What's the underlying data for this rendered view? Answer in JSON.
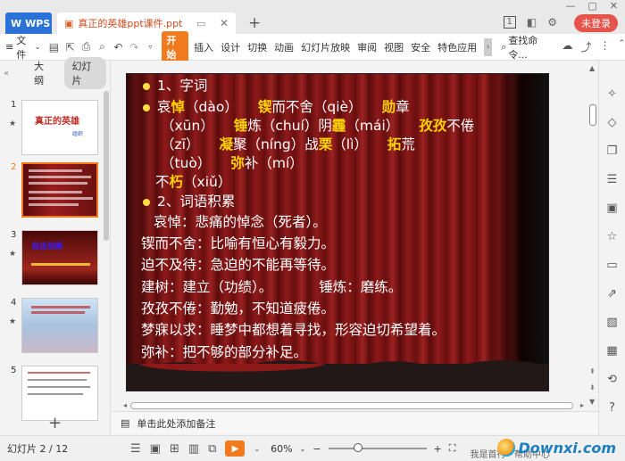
{
  "titlebar": {
    "app_tab": "WPS",
    "doc_tab": "真正的英雄ppt课件.ppt",
    "new_tab": "+",
    "badge": "1",
    "login": "未登录"
  },
  "toolbar": {
    "file": "文件",
    "start": "开始",
    "items": [
      "插入",
      "设计",
      "切换",
      "动画",
      "幻灯片放映",
      "审阅",
      "视图",
      "安全",
      "特色应用"
    ],
    "search": "查找命令..."
  },
  "left_panel": {
    "tab_outline": "大纲",
    "tab_slides": "幻灯片",
    "thumbs": [
      {
        "num": "1",
        "title": "真正的英雄",
        "sub": "组织"
      },
      {
        "num": "2"
      },
      {
        "num": "3",
        "title": "自由创新"
      },
      {
        "num": "4"
      },
      {
        "num": "5"
      }
    ],
    "add": "+"
  },
  "slide": {
    "l1": "1、字词",
    "l2a": "哀",
    "l2b": "悼",
    "l2c": "（dào）",
    "l2d": "锲",
    "l2e": "而不舍（qiè）",
    "l2f": "勋",
    "l2g": "章",
    "l3a": "（xūn）",
    "l3b": "锤",
    "l3c": "炼（chuí）阴",
    "l3d": "霾",
    "l3e": "（mái）",
    "l3f": "孜孜",
    "l3g": "不倦",
    "l4a": "（zī）",
    "l4b": "凝",
    "l4c": "聚（níng）战",
    "l4d": "栗",
    "l4e": "（lì）",
    "l4f": "拓",
    "l4g": "荒",
    "l5a": "（tuò）",
    "l5b": "弥",
    "l5c": "补（mí）",
    "l6a": "不",
    "l6b": "朽",
    "l6c": "（xiǔ）",
    "l7": "2、词语积累",
    "l8": "哀悼：悲痛的悼念（死者）。",
    "l9": "锲而不舍：比喻有恒心有毅力。",
    "l10": "迫不及待：急迫的不能再等待。",
    "l11a": "建树：建立（功绩）。",
    "l11b": "锤炼：磨练。",
    "l12": "孜孜不倦：勤勉，不知道疲倦。",
    "l13": "梦寐以求：睡梦中都想着寻找，形容迫切希望着。",
    "l14": "弥补：把不够的部分补足。"
  },
  "notes": "单击此处添加备注",
  "status": {
    "slide_info": "幻灯片 2 / 12",
    "zoom": "60%",
    "watermark": "Downxi.com",
    "watermark_sub": "我是首行 · 帮助中心"
  }
}
